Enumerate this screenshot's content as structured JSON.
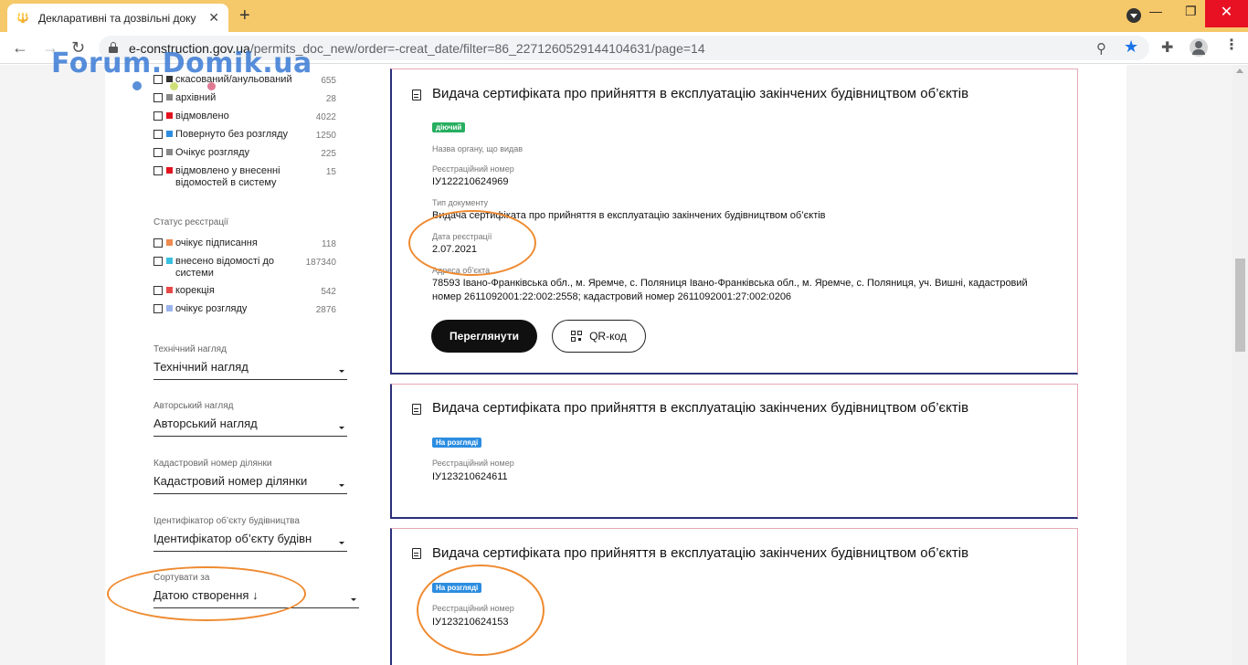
{
  "browser": {
    "tab_title": "Декларативні та дозвільні доку",
    "url_host": "e-construction.gov.ua",
    "url_path": "/permits_doc_new/order=-creat_date/filter=86_2271260529144104631/page=14"
  },
  "watermark": "Forum.Domik.ua",
  "filters": {
    "status_items": [
      {
        "label": "скасований/анульований",
        "count": "655",
        "color": "#333333"
      },
      {
        "label": "архівний",
        "count": "28",
        "color": "#888888"
      },
      {
        "label": "відмовлено",
        "count": "4022",
        "color": "#e2141f"
      },
      {
        "label": "Повернуто без розгляду",
        "count": "1250",
        "color": "#2c8de0"
      },
      {
        "label": "Очікує розгляду",
        "count": "225",
        "color": "#888888"
      },
      {
        "label": "відмовлено у внесенні відомостей в систему",
        "count": "15",
        "color": "#e2141f"
      }
    ],
    "registration_heading": "Статус реєстрації",
    "registration_items": [
      {
        "label": "очікує підписання",
        "count": "118",
        "color": "#ef8a50"
      },
      {
        "label": "внесено відомості до системи",
        "count": "187340",
        "color": "#38c0e0"
      },
      {
        "label": "корекція",
        "count": "542",
        "color": "#e84a4a"
      },
      {
        "label": "очікує розгляду",
        "count": "2876",
        "color": "#9ab4ec"
      }
    ],
    "selects": [
      {
        "label": "Технічний нагляд",
        "value": "Технічний нагляд"
      },
      {
        "label": "Авторський нагляд",
        "value": "Авторський нагляд"
      },
      {
        "label": "Кадастровий номер ділянки",
        "value": "Кадастровий номер ділянки"
      },
      {
        "label": "Ідентифікатор об’єкту будівництва",
        "value": "Ідентифікатор об’єкту будівн"
      },
      {
        "label": "Сортувати за",
        "value": "Датою створення ↓"
      }
    ]
  },
  "cards": [
    {
      "title": "Видача сертифіката про прийняття в експлуатацію закінчених будівництвом об’єктів",
      "badge": "діючий",
      "authority_label": "Назва органу, що видав",
      "reg_number_label": "Реєстраційний номер",
      "reg_number": "ІУ122210624969",
      "doc_type_label": "Тип документу",
      "doc_type": "Видача сертифіката про прийняття в експлуатацію закінчених будівництвом об’єктів",
      "reg_date_label": "Дата реєстрації",
      "reg_date": "2.07.2021",
      "address_label": "Адреса об’єкта",
      "address": "78593 Івано-Франківська обл., м. Яремче, с. Поляниця Івано-Франківська обл., м. Яремче, с. Поляниця, уч. Вишні, кадастровий номер 2611092001:22:002:2558; кадастровий номер 2611092001:27:002:0206",
      "view_button": "Переглянути",
      "qr_button": "QR-код"
    },
    {
      "title": "Видача сертифіката про прийняття в експлуатацію закінчених будівництвом об’єктів",
      "badge": "На розгляді",
      "reg_number_label": "Реєстраційний номер",
      "reg_number": "ІУ123210624611"
    },
    {
      "title": "Видача сертифіката про прийняття в експлуатацію закінчених будівництвом об’єктів",
      "badge": "На розгляді",
      "reg_number_label": "Реєстраційний номер",
      "reg_number": "ІУ123210624153"
    }
  ],
  "colors": {
    "tabbar": "#f5c86a",
    "card_border": "#e6aab5",
    "card_accent": "#2a2f78",
    "badge_active": "#27ae60",
    "badge_review": "#2c8de0",
    "annotation": "#ef8a30",
    "link_star": "#1a73e8"
  }
}
